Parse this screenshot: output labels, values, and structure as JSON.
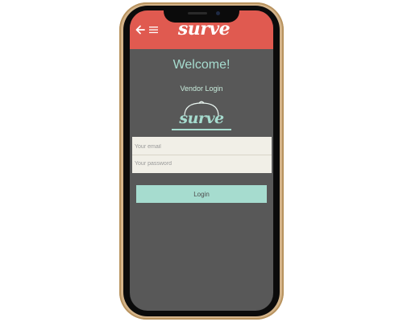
{
  "header": {
    "brand": "surve"
  },
  "main": {
    "welcome": "Welcome!",
    "subtitle": "Vendor Login",
    "logo_text": "surve"
  },
  "form": {
    "email_placeholder": "Your email",
    "password_placeholder": "Your password",
    "login_label": "Login"
  },
  "icons": {
    "back": "arrow-left-icon",
    "menu": "hamburger-menu-icon",
    "logo": "serving-cloche-icon"
  },
  "colors": {
    "header": "#e05a50",
    "background": "#585858",
    "accent": "#a6dccf",
    "form_panel": "#f1efe7"
  }
}
